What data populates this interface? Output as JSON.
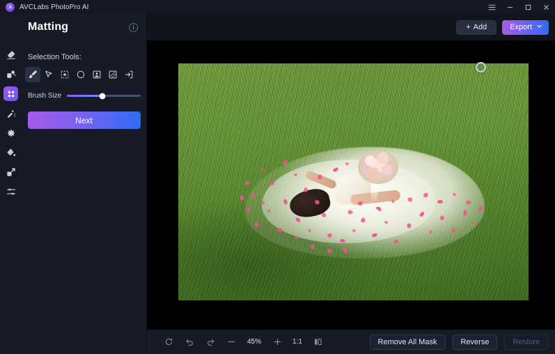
{
  "titlebar": {
    "app_name": "AVCLabs PhotoPro AI",
    "logo_icon": "avclabs-logo-icon",
    "menu_icon": "hamburger-menu-icon",
    "minimize_icon": "minimize-icon",
    "maximize_icon": "maximize-icon",
    "close_icon": "close-icon"
  },
  "rail": {
    "items": [
      {
        "icon": "eraser-icon",
        "name": "object-eraser",
        "active": false
      },
      {
        "icon": "background-replace-icon",
        "name": "background-remover",
        "active": false
      },
      {
        "icon": "matting-icon",
        "name": "matting",
        "active": true
      },
      {
        "icon": "magic-wand-icon",
        "name": "ai-retouch",
        "active": false
      },
      {
        "icon": "enhance-icon",
        "name": "photo-enhancer",
        "active": false
      },
      {
        "icon": "colorize-icon",
        "name": "colorizer",
        "active": false
      },
      {
        "icon": "upscale-icon",
        "name": "upscaler",
        "active": false
      },
      {
        "icon": "adjust-sliders-icon",
        "name": "adjustments",
        "active": false
      }
    ]
  },
  "panel": {
    "title": "Matting",
    "info_icon": "info-icon",
    "info_glyph": "i",
    "section_label": "Selection Tools:",
    "tools": [
      {
        "name": "brush-tool",
        "icon": "brush-icon",
        "active": true
      },
      {
        "name": "magic-pointer-tool",
        "icon": "pointer-wand-icon",
        "active": false
      },
      {
        "name": "rectangle-select-tool",
        "icon": "dashed-rectangle-icon",
        "active": false
      },
      {
        "name": "ellipse-select-tool",
        "icon": "circle-icon",
        "active": false
      },
      {
        "name": "subject-select-tool",
        "icon": "portrait-box-icon",
        "active": false
      },
      {
        "name": "pattern-select-tool",
        "icon": "hatched-box-icon",
        "active": false
      },
      {
        "name": "import-selection-tool",
        "icon": "arrow-into-box-icon",
        "active": false
      }
    ],
    "brush_size_label": "Brush Size",
    "brush_size_percent": 48,
    "next_label": "Next"
  },
  "topbar": {
    "add_label": "Add",
    "add_plus": "+",
    "add_icon": "plus-icon",
    "export_label": "Export",
    "export_caret_icon": "chevron-down-icon"
  },
  "canvas": {
    "image_alt": "bride-lying-on-grass-photo",
    "brush_cursor_icon": "brush-cursor-ring"
  },
  "bottombar": {
    "reset_icon": "reset-rotate-icon",
    "undo_icon": "undo-icon",
    "redo_icon": "redo-icon",
    "zoom_out_icon": "minus-icon",
    "zoom_value": "45%",
    "zoom_in_icon": "plus-icon",
    "fit_ratio": "1:1",
    "compare_icon": "split-compare-icon",
    "remove_all_mask_label": "Remove All Mask",
    "reverse_label": "Reverse",
    "restore_label": "Restore",
    "restore_disabled": true
  },
  "colors": {
    "accent_purple": "#a75ae8",
    "accent_blue": "#2f6bf5",
    "panel_bg": "#171b27",
    "titlebar_bg": "#151824",
    "canvas_bg": "#000000",
    "petal_pink": "#f6508f"
  }
}
